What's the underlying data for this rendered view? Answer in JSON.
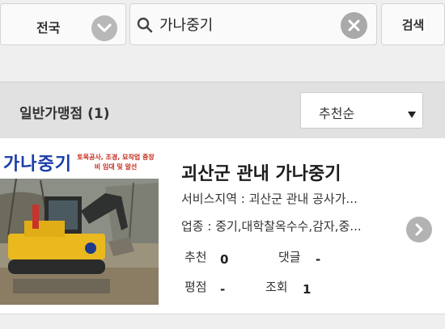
{
  "filters": {
    "region": "전국",
    "search_value": "가나중기",
    "search_button": "검색"
  },
  "list": {
    "section_title": "일반가맹점 (1)",
    "sort_selected": "추천순",
    "items": [
      {
        "name": "괴산군 관내 가나중기",
        "thumb_title": "가나중기",
        "thumb_caption": "토목공사, 조경, 묘작업 중장비 임대 및 알선",
        "service_area": "서비스지역 : 괴산군 관내 공사가...",
        "industry": "업종 : 중기,대학찰옥수수,감자,중...",
        "recommend_label": "추천",
        "recommend_value": "0",
        "comment_label": "댓글",
        "comment_value": "-",
        "rating_label": "평점",
        "rating_value": "-",
        "views_label": "조회",
        "views_value": "1"
      }
    ]
  },
  "icons": {
    "region_dropdown": "chevron-down-icon",
    "search": "search-icon",
    "clear": "close-icon",
    "sort": "caret-down-icon",
    "detail": "chevron-right-icon"
  }
}
